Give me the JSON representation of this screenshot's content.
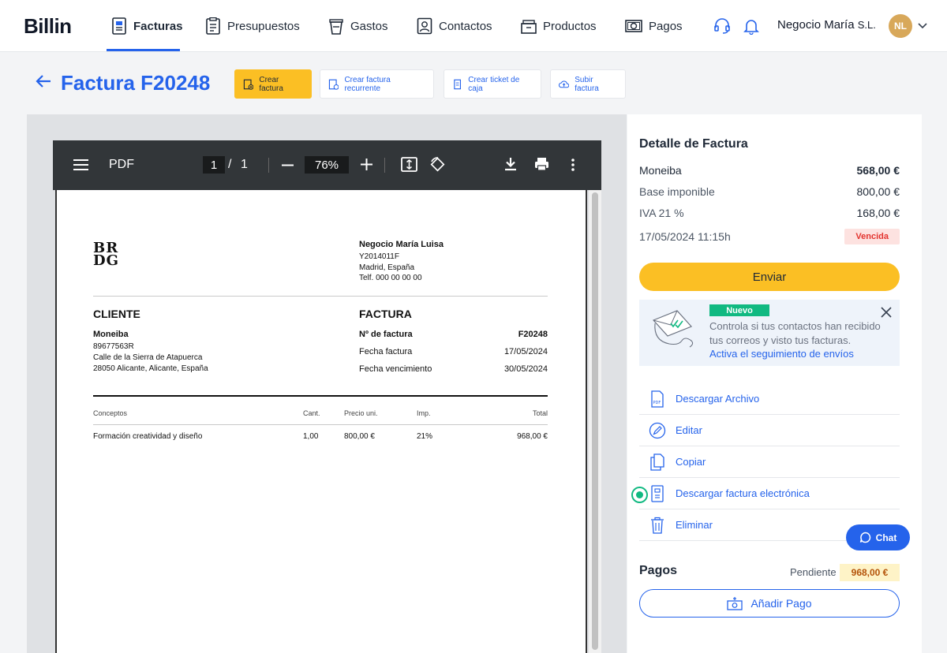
{
  "brand": {
    "logo": "Billin",
    "accent": "#2563eb",
    "yellow": "#fbbf24"
  },
  "nav": {
    "items": [
      {
        "label": "Facturas",
        "icon": "invoice-icon",
        "active": true
      },
      {
        "label": "Presupuestos",
        "icon": "budget-icon"
      },
      {
        "label": "Gastos",
        "icon": "cup-icon"
      },
      {
        "label": "Contactos",
        "icon": "contact-icon"
      },
      {
        "label": "Productos",
        "icon": "box-icon"
      },
      {
        "label": "Pagos",
        "icon": "payment-icon"
      }
    ],
    "company": "Negocio María",
    "company_suffix": "S.L.",
    "avatar": "NL"
  },
  "header": {
    "title": "Factura F20248",
    "buttons": {
      "crear_factura": "Crear factura",
      "crear_recurrente": "Crear factura recurrente",
      "crear_ticket": "Crear ticket de caja",
      "subir_factura": "Subir factura"
    }
  },
  "pdf": {
    "label": "PDF",
    "page_current": "1",
    "page_sep": "/",
    "page_total": "1",
    "zoom": "76%",
    "document": {
      "logo_line1": "BR",
      "logo_line2": "DG",
      "issuer_name": "Negocio María Luisa",
      "issuer_nif": "Y2014011F",
      "issuer_city": "Madrid, España",
      "issuer_phone": "Telf. 000 00 00 00",
      "client_heading": "CLIENTE",
      "invoice_heading": "FACTURA",
      "client_name": "Moneiba",
      "client_nif": "89677563R",
      "client_address": "Calle de la Sierra de Atapuerca",
      "client_city": "28050 Alicante, Alicante, España",
      "invoice_number_label": "Nº de factura",
      "invoice_number": "F20248",
      "invoice_date_label": "Fecha factura",
      "invoice_date": "17/05/2024",
      "due_date_label": "Fecha vencimiento",
      "due_date": "30/05/2024",
      "table_headers": [
        "Conceptos",
        "Cant.",
        "Precio uni.",
        "Imp.",
        "Total"
      ],
      "rows": [
        {
          "concepto": "Formación creatividad y diseño",
          "cant": "1,00",
          "precio": "800,00 €",
          "imp": "21%",
          "total": "968,00 €"
        }
      ]
    }
  },
  "detail": {
    "title": "Detalle de Factura",
    "client": "Moneiba",
    "client_amount": "568,00 €",
    "base_label": "Base imponible",
    "base_amount": "800,00 €",
    "iva_label": "IVA 21 %",
    "iva_amount": "168,00 €",
    "datetime": "17/05/2024 11:15h",
    "status": "Vencida",
    "send_label": "Enviar"
  },
  "promo": {
    "badge": "Nuevo",
    "text": "Controla si tus contactos han recibido tus correos y visto tus facturas.",
    "link": "Activa el seguimiento de envíos"
  },
  "actions": [
    {
      "label": "Descargar Archivo",
      "icon": "pdf-file-icon"
    },
    {
      "label": "Editar",
      "icon": "pencil-icon"
    },
    {
      "label": "Copiar",
      "icon": "copy-icon"
    },
    {
      "label": "Descargar factura electrónica",
      "icon": "e-invoice-icon"
    },
    {
      "label": "Eliminar",
      "icon": "trash-icon"
    }
  ],
  "chat": {
    "label": "Chat"
  },
  "payments": {
    "title": "Pagos",
    "status_label": "Pendiente",
    "pending_amount": "968,00 €",
    "add_label": "Añadir Pago"
  }
}
